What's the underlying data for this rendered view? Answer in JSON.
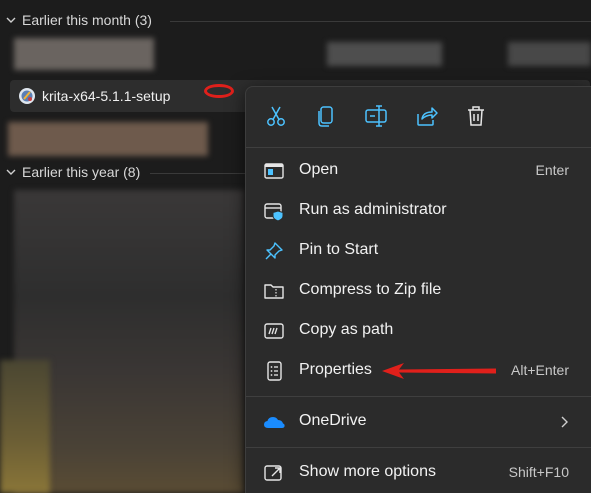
{
  "groups": [
    {
      "label": "Earlier this month (3)"
    },
    {
      "label": "Earlier this year (8)"
    }
  ],
  "selected_file": {
    "name": "krita-x64-5.1.1-setup"
  },
  "quick_actions": [
    {
      "icon": "cut-icon"
    },
    {
      "icon": "copy-icon"
    },
    {
      "icon": "rename-icon"
    },
    {
      "icon": "share-icon"
    },
    {
      "icon": "delete-icon"
    }
  ],
  "menu": {
    "open": {
      "label": "Open",
      "shortcut": "Enter"
    },
    "run_admin": {
      "label": "Run as administrator"
    },
    "pin_start": {
      "label": "Pin to Start"
    },
    "compress_zip": {
      "label": "Compress to Zip file"
    },
    "copy_path": {
      "label": "Copy as path"
    },
    "properties": {
      "label": "Properties",
      "shortcut": "Alt+Enter"
    },
    "onedrive": {
      "label": "OneDrive"
    },
    "show_more": {
      "label": "Show more options",
      "shortcut": "Shift+F10"
    }
  },
  "colors": {
    "accent_blue": "#4cc2ff",
    "annotation_red": "#e0201b",
    "menu_bg": "#2b2b2b",
    "page_bg": "#1c1c1c"
  }
}
